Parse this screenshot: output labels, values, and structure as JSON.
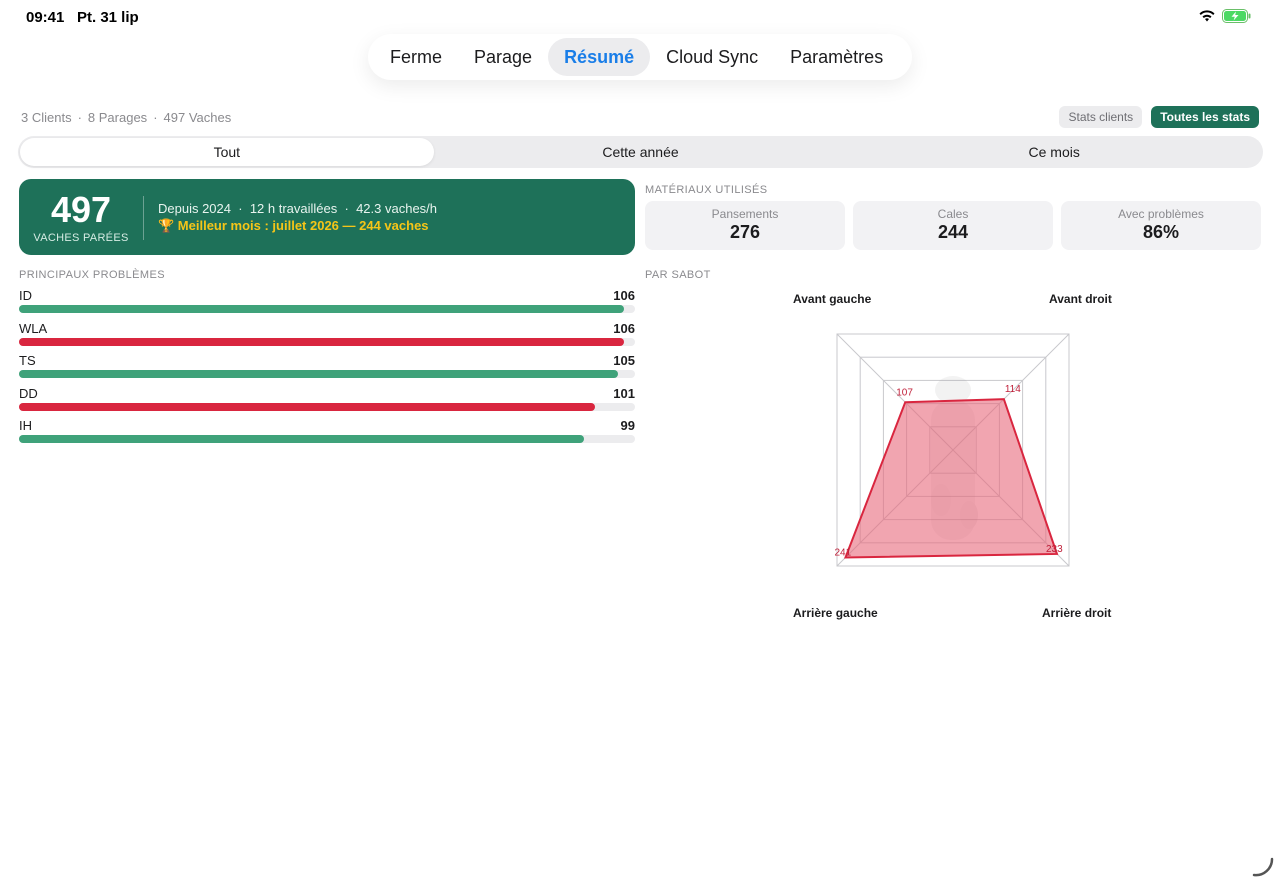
{
  "status": {
    "time": "09:41",
    "date": "Pt. 31 lip"
  },
  "tabs": [
    {
      "label": "Ferme",
      "active": false
    },
    {
      "label": "Parage",
      "active": false
    },
    {
      "label": "Résumé",
      "active": true
    },
    {
      "label": "Cloud Sync",
      "active": false
    },
    {
      "label": "Paramètres",
      "active": false
    }
  ],
  "summary": {
    "clients": "3 Clients",
    "parages": "8 Parages",
    "vaches": "497 Vaches"
  },
  "buttons": {
    "stats_clients": "Stats clients",
    "all_stats": "Toutes les stats"
  },
  "period": {
    "options": [
      "Tout",
      "Cette année",
      "Ce mois"
    ],
    "selected": "Tout"
  },
  "hero": {
    "count": "497",
    "count_label": "VACHES PARÉES",
    "since": "Depuis 2024",
    "hours": "12 h travaillées",
    "rate": "42.3 vaches/h",
    "best_month_icon": "trophy-icon",
    "best_month": "🏆 Meilleur mois : juillet 2026 — 244 vaches"
  },
  "materials": {
    "title": "MATÉRIAUX UTILISÉS",
    "items": [
      {
        "label": "Pansements",
        "value": "276"
      },
      {
        "label": "Cales",
        "value": "244"
      },
      {
        "label": "Avec problèmes",
        "value": "86%"
      }
    ]
  },
  "problems": {
    "title": "PRINCIPAUX PROBLÈMES",
    "max": 106,
    "items": [
      {
        "name": "ID",
        "value": 106,
        "color": "#3fa27a"
      },
      {
        "name": "WLA",
        "value": 106,
        "color": "#d9263f"
      },
      {
        "name": "TS",
        "value": 105,
        "color": "#3fa27a"
      },
      {
        "name": "DD",
        "value": 101,
        "color": "#d9263f"
      },
      {
        "name": "IH",
        "value": 99,
        "color": "#3fa27a"
      }
    ]
  },
  "hoof": {
    "title": "PAR SABOT",
    "labels": {
      "front_left": "Avant gauche",
      "front_right": "Avant droit",
      "rear_left": "Arrière gauche",
      "rear_right": "Arrière droit"
    },
    "chart_data": {
      "type": "radar",
      "categories": [
        "Avant gauche",
        "Avant droit",
        "Arrière droit",
        "Arrière gauche"
      ],
      "values": [
        107,
        114,
        233,
        241
      ],
      "max": 260,
      "value_labels": [
        "107",
        "114",
        "233",
        "241"
      ],
      "fill_color": "#e8697b",
      "line_color": "#d9263f"
    }
  }
}
